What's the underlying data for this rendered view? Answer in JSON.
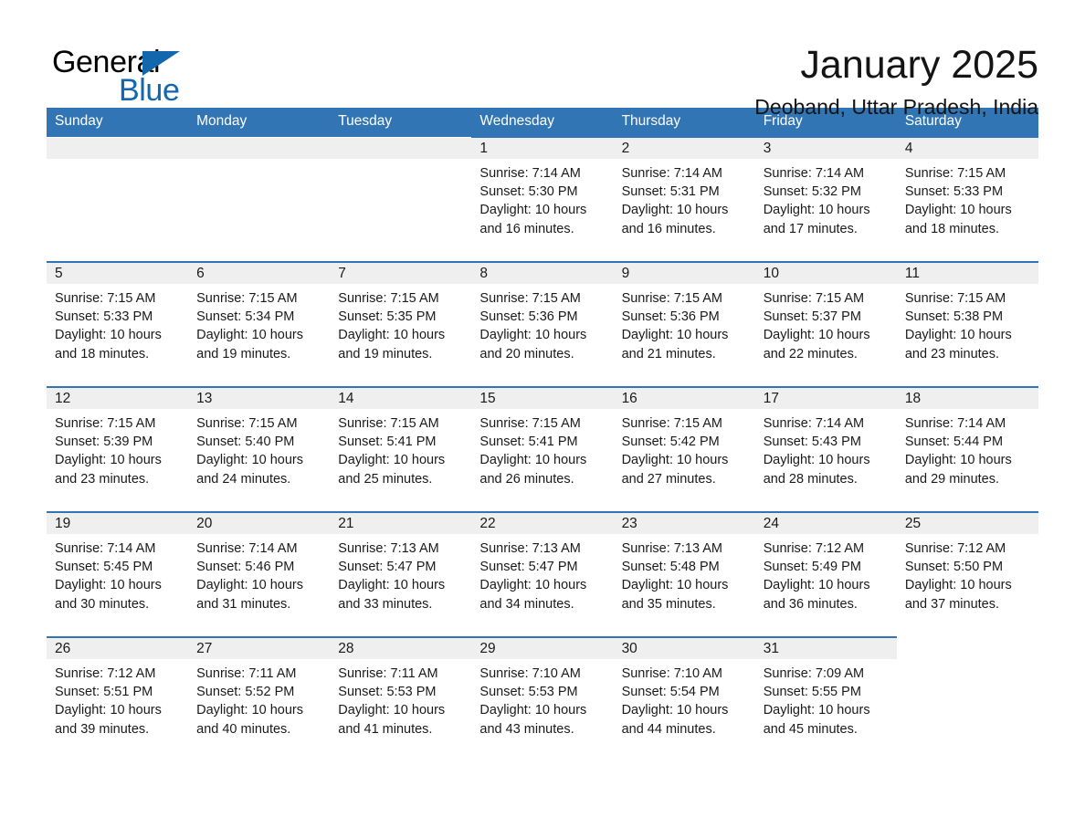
{
  "brand": {
    "name_part1": "General",
    "name_part2": "Blue",
    "triangle_color": "#1267ad"
  },
  "header": {
    "month_title": "January 2025",
    "location": "Deoband, Uttar Pradesh, India",
    "accent_color": "#3275b4"
  },
  "calendar": {
    "weekday_headers": [
      "Sunday",
      "Monday",
      "Tuesday",
      "Wednesday",
      "Thursday",
      "Friday",
      "Saturday"
    ],
    "weeks": [
      [
        {
          "day": "",
          "empty": true
        },
        {
          "day": "",
          "empty": true
        },
        {
          "day": "",
          "empty": true
        },
        {
          "day": "1",
          "sunrise": "Sunrise: 7:14 AM",
          "sunset": "Sunset: 5:30 PM",
          "daylight_line1": "Daylight: 10 hours",
          "daylight_line2": "and 16 minutes."
        },
        {
          "day": "2",
          "sunrise": "Sunrise: 7:14 AM",
          "sunset": "Sunset: 5:31 PM",
          "daylight_line1": "Daylight: 10 hours",
          "daylight_line2": "and 16 minutes."
        },
        {
          "day": "3",
          "sunrise": "Sunrise: 7:14 AM",
          "sunset": "Sunset: 5:32 PM",
          "daylight_line1": "Daylight: 10 hours",
          "daylight_line2": "and 17 minutes."
        },
        {
          "day": "4",
          "sunrise": "Sunrise: 7:15 AM",
          "sunset": "Sunset: 5:33 PM",
          "daylight_line1": "Daylight: 10 hours",
          "daylight_line2": "and 18 minutes."
        }
      ],
      [
        {
          "day": "5",
          "sunrise": "Sunrise: 7:15 AM",
          "sunset": "Sunset: 5:33 PM",
          "daylight_line1": "Daylight: 10 hours",
          "daylight_line2": "and 18 minutes."
        },
        {
          "day": "6",
          "sunrise": "Sunrise: 7:15 AM",
          "sunset": "Sunset: 5:34 PM",
          "daylight_line1": "Daylight: 10 hours",
          "daylight_line2": "and 19 minutes."
        },
        {
          "day": "7",
          "sunrise": "Sunrise: 7:15 AM",
          "sunset": "Sunset: 5:35 PM",
          "daylight_line1": "Daylight: 10 hours",
          "daylight_line2": "and 19 minutes."
        },
        {
          "day": "8",
          "sunrise": "Sunrise: 7:15 AM",
          "sunset": "Sunset: 5:36 PM",
          "daylight_line1": "Daylight: 10 hours",
          "daylight_line2": "and 20 minutes."
        },
        {
          "day": "9",
          "sunrise": "Sunrise: 7:15 AM",
          "sunset": "Sunset: 5:36 PM",
          "daylight_line1": "Daylight: 10 hours",
          "daylight_line2": "and 21 minutes."
        },
        {
          "day": "10",
          "sunrise": "Sunrise: 7:15 AM",
          "sunset": "Sunset: 5:37 PM",
          "daylight_line1": "Daylight: 10 hours",
          "daylight_line2": "and 22 minutes."
        },
        {
          "day": "11",
          "sunrise": "Sunrise: 7:15 AM",
          "sunset": "Sunset: 5:38 PM",
          "daylight_line1": "Daylight: 10 hours",
          "daylight_line2": "and 23 minutes."
        }
      ],
      [
        {
          "day": "12",
          "sunrise": "Sunrise: 7:15 AM",
          "sunset": "Sunset: 5:39 PM",
          "daylight_line1": "Daylight: 10 hours",
          "daylight_line2": "and 23 minutes."
        },
        {
          "day": "13",
          "sunrise": "Sunrise: 7:15 AM",
          "sunset": "Sunset: 5:40 PM",
          "daylight_line1": "Daylight: 10 hours",
          "daylight_line2": "and 24 minutes."
        },
        {
          "day": "14",
          "sunrise": "Sunrise: 7:15 AM",
          "sunset": "Sunset: 5:41 PM",
          "daylight_line1": "Daylight: 10 hours",
          "daylight_line2": "and 25 minutes."
        },
        {
          "day": "15",
          "sunrise": "Sunrise: 7:15 AM",
          "sunset": "Sunset: 5:41 PM",
          "daylight_line1": "Daylight: 10 hours",
          "daylight_line2": "and 26 minutes."
        },
        {
          "day": "16",
          "sunrise": "Sunrise: 7:15 AM",
          "sunset": "Sunset: 5:42 PM",
          "daylight_line1": "Daylight: 10 hours",
          "daylight_line2": "and 27 minutes."
        },
        {
          "day": "17",
          "sunrise": "Sunrise: 7:14 AM",
          "sunset": "Sunset: 5:43 PM",
          "daylight_line1": "Daylight: 10 hours",
          "daylight_line2": "and 28 minutes."
        },
        {
          "day": "18",
          "sunrise": "Sunrise: 7:14 AM",
          "sunset": "Sunset: 5:44 PM",
          "daylight_line1": "Daylight: 10 hours",
          "daylight_line2": "and 29 minutes."
        }
      ],
      [
        {
          "day": "19",
          "sunrise": "Sunrise: 7:14 AM",
          "sunset": "Sunset: 5:45 PM",
          "daylight_line1": "Daylight: 10 hours",
          "daylight_line2": "and 30 minutes."
        },
        {
          "day": "20",
          "sunrise": "Sunrise: 7:14 AM",
          "sunset": "Sunset: 5:46 PM",
          "daylight_line1": "Daylight: 10 hours",
          "daylight_line2": "and 31 minutes."
        },
        {
          "day": "21",
          "sunrise": "Sunrise: 7:13 AM",
          "sunset": "Sunset: 5:47 PM",
          "daylight_line1": "Daylight: 10 hours",
          "daylight_line2": "and 33 minutes."
        },
        {
          "day": "22",
          "sunrise": "Sunrise: 7:13 AM",
          "sunset": "Sunset: 5:47 PM",
          "daylight_line1": "Daylight: 10 hours",
          "daylight_line2": "and 34 minutes."
        },
        {
          "day": "23",
          "sunrise": "Sunrise: 7:13 AM",
          "sunset": "Sunset: 5:48 PM",
          "daylight_line1": "Daylight: 10 hours",
          "daylight_line2": "and 35 minutes."
        },
        {
          "day": "24",
          "sunrise": "Sunrise: 7:12 AM",
          "sunset": "Sunset: 5:49 PM",
          "daylight_line1": "Daylight: 10 hours",
          "daylight_line2": "and 36 minutes."
        },
        {
          "day": "25",
          "sunrise": "Sunrise: 7:12 AM",
          "sunset": "Sunset: 5:50 PM",
          "daylight_line1": "Daylight: 10 hours",
          "daylight_line2": "and 37 minutes."
        }
      ],
      [
        {
          "day": "26",
          "sunrise": "Sunrise: 7:12 AM",
          "sunset": "Sunset: 5:51 PM",
          "daylight_line1": "Daylight: 10 hours",
          "daylight_line2": "and 39 minutes."
        },
        {
          "day": "27",
          "sunrise": "Sunrise: 7:11 AM",
          "sunset": "Sunset: 5:52 PM",
          "daylight_line1": "Daylight: 10 hours",
          "daylight_line2": "and 40 minutes."
        },
        {
          "day": "28",
          "sunrise": "Sunrise: 7:11 AM",
          "sunset": "Sunset: 5:53 PM",
          "daylight_line1": "Daylight: 10 hours",
          "daylight_line2": "and 41 minutes."
        },
        {
          "day": "29",
          "sunrise": "Sunrise: 7:10 AM",
          "sunset": "Sunset: 5:53 PM",
          "daylight_line1": "Daylight: 10 hours",
          "daylight_line2": "and 43 minutes."
        },
        {
          "day": "30",
          "sunrise": "Sunrise: 7:10 AM",
          "sunset": "Sunset: 5:54 PM",
          "daylight_line1": "Daylight: 10 hours",
          "daylight_line2": "and 44 minutes."
        },
        {
          "day": "31",
          "sunrise": "Sunrise: 7:09 AM",
          "sunset": "Sunset: 5:55 PM",
          "daylight_line1": "Daylight: 10 hours",
          "daylight_line2": "and 45 minutes."
        },
        {
          "day": "",
          "trailing": true
        }
      ]
    ]
  }
}
